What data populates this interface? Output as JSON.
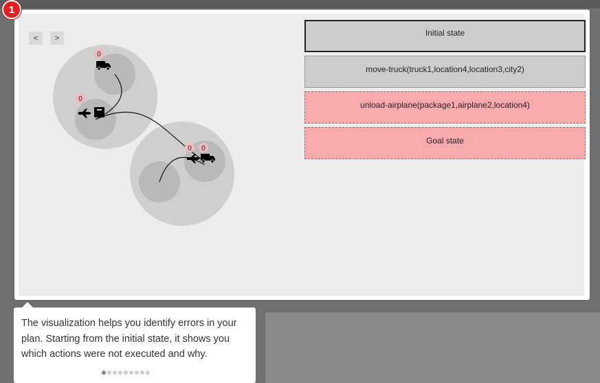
{
  "step_badge": "1",
  "nav": {
    "prev": "<",
    "next": ">"
  },
  "counters": {
    "truck_top": "0",
    "plane_left": "0",
    "plane_right": "0",
    "truck_right": "0"
  },
  "plan_steps": [
    {
      "label": "Initial state",
      "status": "initial"
    },
    {
      "label": "move-truck(truck1,location4,location3,city2)",
      "status": "executed"
    },
    {
      "label": "unload-airplane(package1,airplane2,location4)",
      "status": "failed"
    },
    {
      "label": "Goal state",
      "status": "failed"
    }
  ],
  "tooltip": {
    "text": "The visualization helps you identify errors in your plan. Starting from the initial state, it shows you which actions were not executed and why.",
    "dots": 9,
    "active_dot": 0
  },
  "colors": {
    "failed": "#f9aaad",
    "executed": "#cccccc",
    "badge": "#e02021",
    "counter_bg": "#f3b8c2"
  },
  "icons": [
    "truck-icon",
    "airplane-icon",
    "package-icon"
  ]
}
